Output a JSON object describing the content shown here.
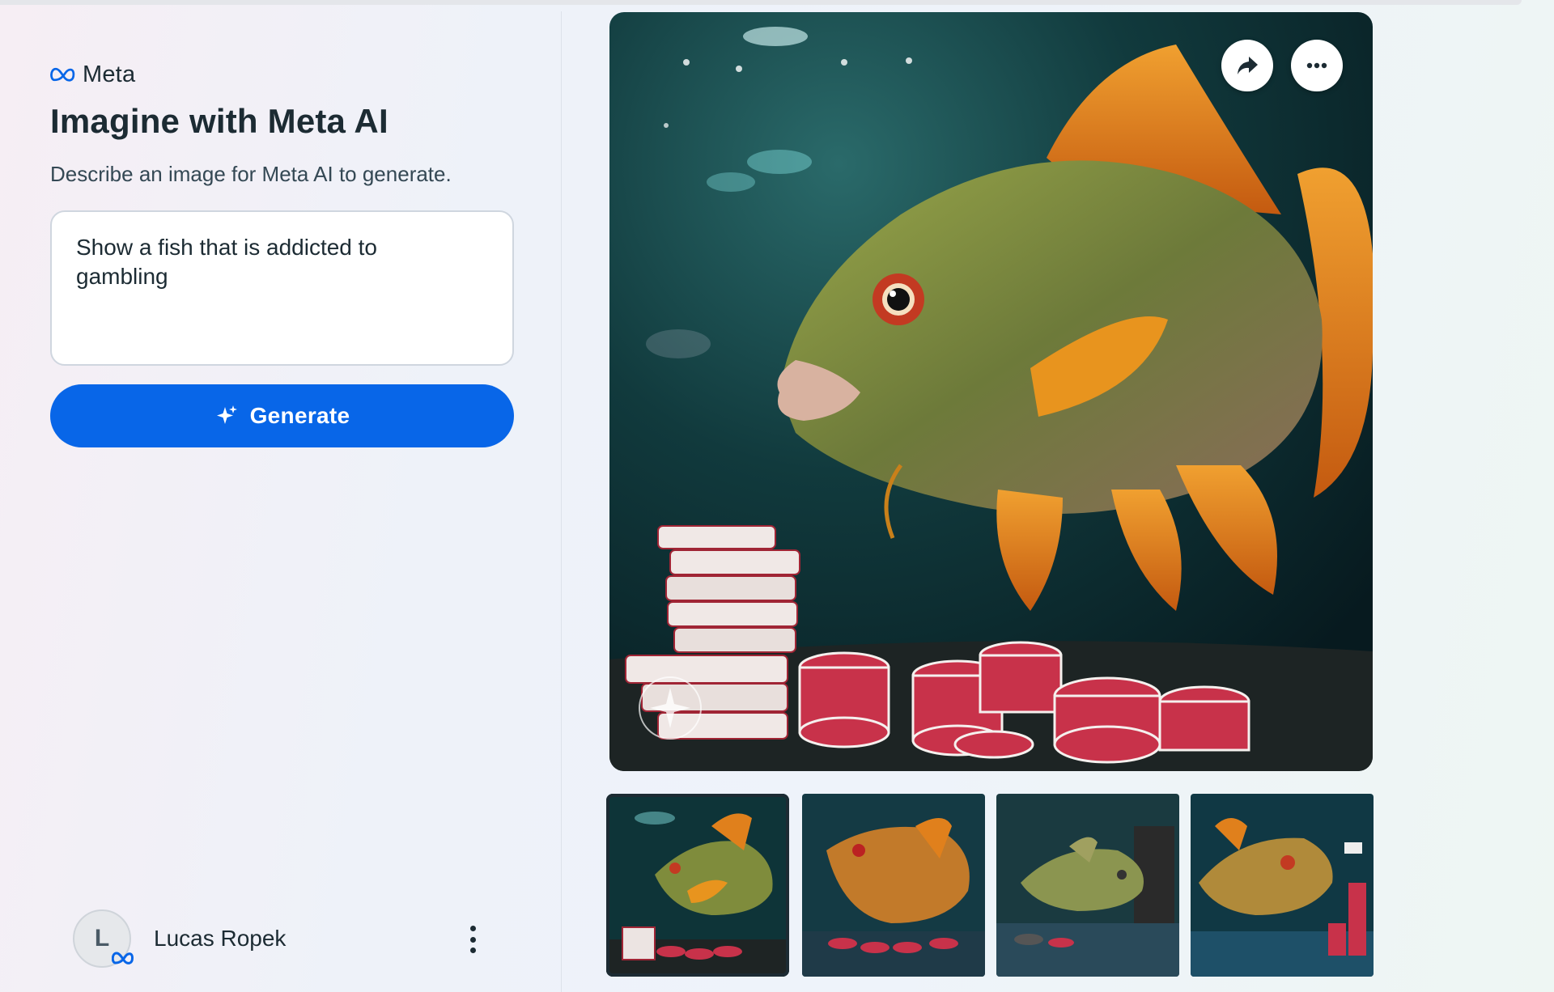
{
  "brand": {
    "name": "Meta",
    "logo_icon": "meta-infinity-icon"
  },
  "page": {
    "title": "Imagine with Meta AI",
    "subtitle": "Describe an image for Meta AI to generate."
  },
  "prompt": {
    "value": "Show a fish that is addicted to gambling"
  },
  "generate": {
    "label": "Generate",
    "icon": "sparkle-icon"
  },
  "user": {
    "initial": "L",
    "name": "Lucas Ropek",
    "menu_icon": "vertical-ellipsis-icon"
  },
  "main_image": {
    "description_icon": "generated-image",
    "actions": [
      {
        "name": "share",
        "icon": "share-arrow-icon"
      },
      {
        "name": "more",
        "icon": "more-horizontal-icon"
      }
    ]
  },
  "thumbnails": [
    {
      "index": 1,
      "selected": true
    },
    {
      "index": 2,
      "selected": false
    },
    {
      "index": 3,
      "selected": false
    },
    {
      "index": 4,
      "selected": false
    }
  ],
  "colors": {
    "primary": "#0866e8",
    "text": "#1c2b33",
    "water": "#0f3a3c",
    "fish_fin": "#e07a1f",
    "chip_red": "#c8324a"
  }
}
